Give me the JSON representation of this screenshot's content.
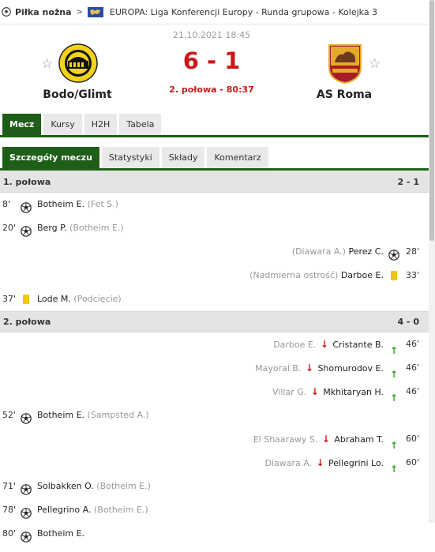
{
  "breadcrumb": {
    "sport": "Piłka nożna",
    "separator": ">",
    "competition": "EUROPA: Liga Konferencji Europy - Runda grupowa - Kolejka 3"
  },
  "match": {
    "date": "21.10.2021 18:45",
    "home_team": "Bodo/Glimt",
    "away_team": "AS Roma",
    "score": "6 - 1",
    "status": "2. połowa - 80:37",
    "favorite_icon": "☆"
  },
  "colors": {
    "accent_green": "#1f5e18",
    "score_red": "#cc1818",
    "yellow_card": "#f2c617",
    "sub_in": "#3aa12c",
    "sub_out": "#d01818"
  },
  "tabs": [
    "Mecz",
    "Kursy",
    "H2H",
    "Tabela"
  ],
  "subtabs": [
    "Szczegóły meczu",
    "Statystyki",
    "Składy",
    "Komentarz"
  ],
  "halves": [
    {
      "title": "1. połowa",
      "score": "2 - 1",
      "events": [
        {
          "side": "home",
          "type": "goal",
          "minute": "8'",
          "player": "Botheim E.",
          "assist": "(Fet S.)"
        },
        {
          "side": "home",
          "type": "goal",
          "minute": "20'",
          "player": "Berg P.",
          "assist": "(Botheim E.)"
        },
        {
          "side": "away",
          "type": "goal",
          "minute": "28'",
          "player": "Perez C.",
          "assist": "(Diawara A.)"
        },
        {
          "side": "away",
          "type": "yellow-card",
          "minute": "33'",
          "player": "Darboe E.",
          "assist": "(Nadmierna ostrość)"
        },
        {
          "side": "home",
          "type": "yellow-card",
          "minute": "37'",
          "player": "Lode M.",
          "assist": "(Podcięcie)"
        }
      ]
    },
    {
      "title": "2. połowa",
      "score": "4 - 0",
      "events": [
        {
          "side": "away",
          "type": "substitution",
          "minute": "46'",
          "player_out": "Darboe E.",
          "player_in": "Cristante B."
        },
        {
          "side": "away",
          "type": "substitution",
          "minute": "46'",
          "player_out": "Mayoral B.",
          "player_in": "Shomurodov E."
        },
        {
          "side": "away",
          "type": "substitution",
          "minute": "46'",
          "player_out": "Villar G.",
          "player_in": "Mkhitaryan H."
        },
        {
          "side": "home",
          "type": "goal",
          "minute": "52'",
          "player": "Botheim E.",
          "assist": "(Sampsted A.)"
        },
        {
          "side": "away",
          "type": "substitution",
          "minute": "60'",
          "player_out": "El Shaarawy S.",
          "player_in": "Abraham T."
        },
        {
          "side": "away",
          "type": "substitution",
          "minute": "60'",
          "player_out": "Diawara A.",
          "player_in": "Pellegrini Lo."
        },
        {
          "side": "home",
          "type": "goal",
          "minute": "71'",
          "player": "Solbakken O.",
          "assist": "(Botheim E.)"
        },
        {
          "side": "home",
          "type": "goal",
          "minute": "78'",
          "player": "Pellegrino A.",
          "assist": "(Botheim E.)"
        },
        {
          "side": "home",
          "type": "goal",
          "minute": "80'",
          "player": "Botheim E.",
          "assist": ""
        }
      ]
    }
  ]
}
